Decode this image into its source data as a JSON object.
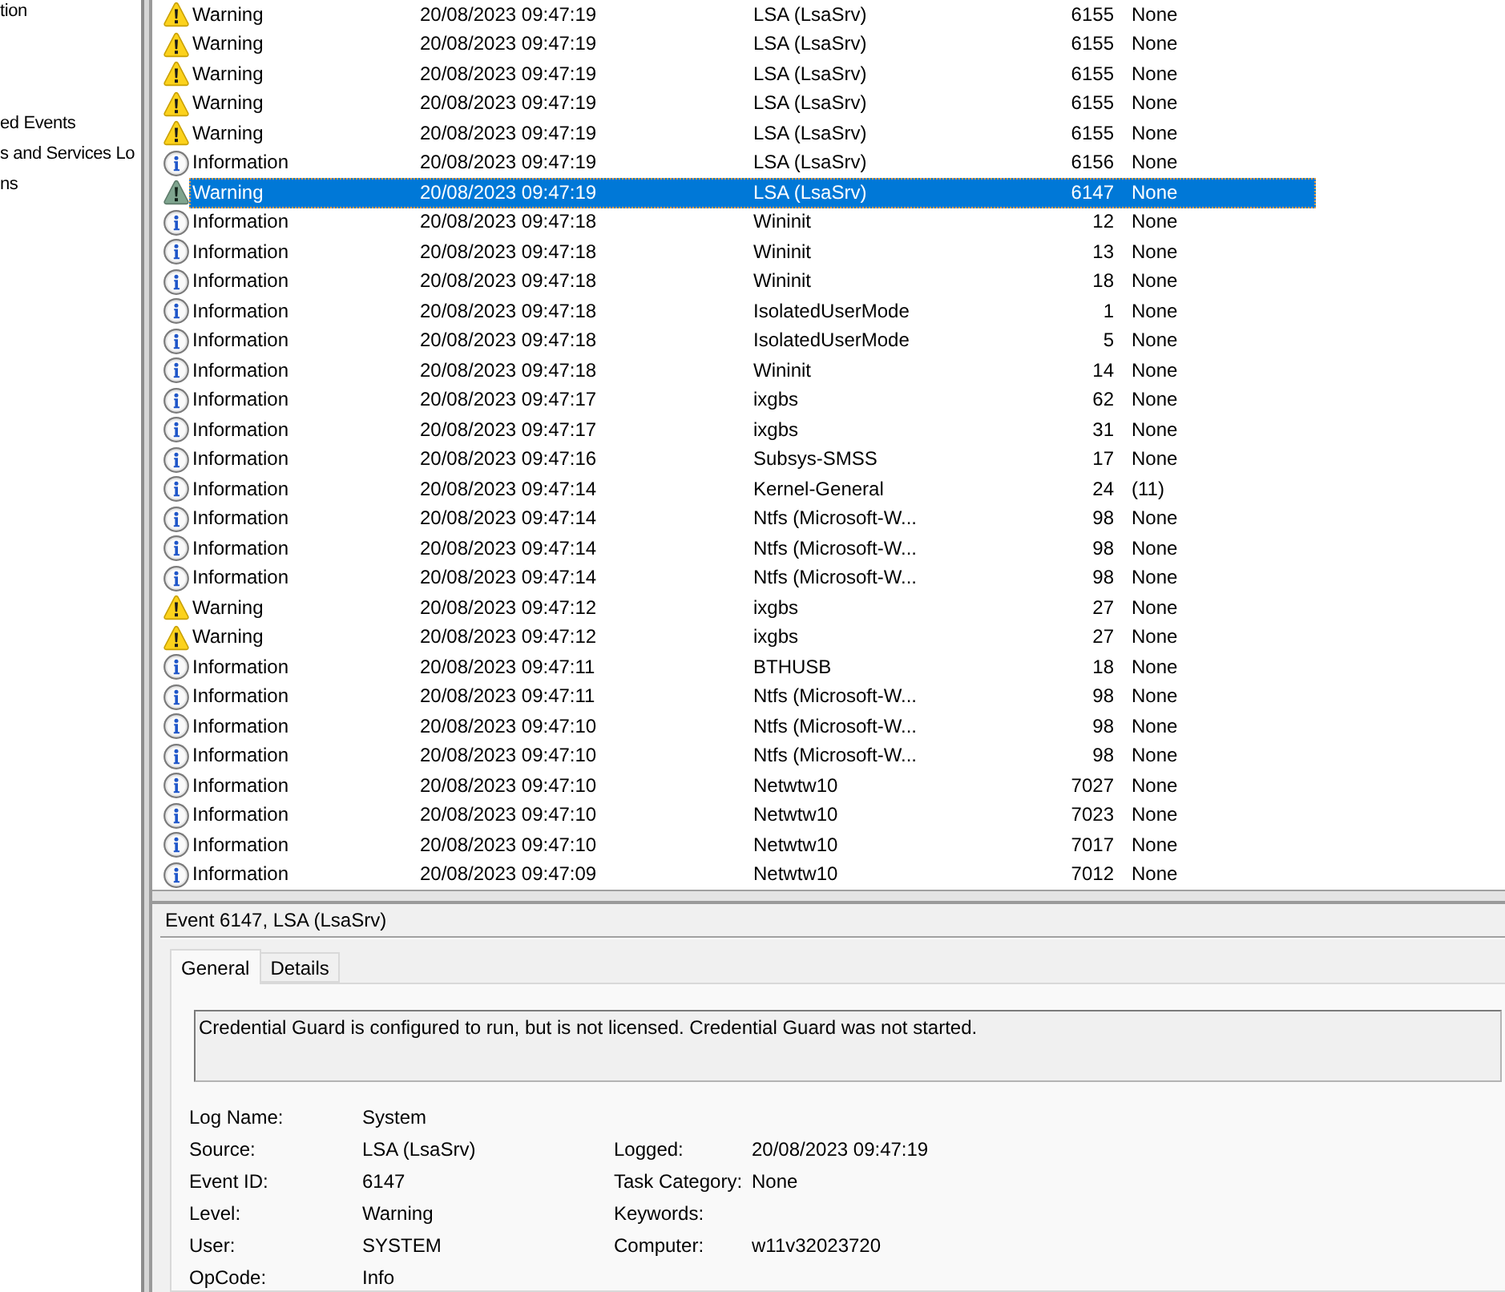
{
  "sidebar": {
    "items": [
      {
        "label": "tion"
      },
      {
        "label": "ed Events"
      },
      {
        "label": "s and Services Lo"
      },
      {
        "label": "ns"
      }
    ]
  },
  "events": {
    "rows": [
      {
        "kind": "warning",
        "level": "Warning",
        "date_time": "20/08/2023 09:47:19",
        "source": "LSA (LsaSrv)",
        "event_id": "6155",
        "task_category": "None",
        "selected": false
      },
      {
        "kind": "warning",
        "level": "Warning",
        "date_time": "20/08/2023 09:47:19",
        "source": "LSA (LsaSrv)",
        "event_id": "6155",
        "task_category": "None",
        "selected": false
      },
      {
        "kind": "warning",
        "level": "Warning",
        "date_time": "20/08/2023 09:47:19",
        "source": "LSA (LsaSrv)",
        "event_id": "6155",
        "task_category": "None",
        "selected": false
      },
      {
        "kind": "warning",
        "level": "Warning",
        "date_time": "20/08/2023 09:47:19",
        "source": "LSA (LsaSrv)",
        "event_id": "6155",
        "task_category": "None",
        "selected": false
      },
      {
        "kind": "warning",
        "level": "Warning",
        "date_time": "20/08/2023 09:47:19",
        "source": "LSA (LsaSrv)",
        "event_id": "6155",
        "task_category": "None",
        "selected": false
      },
      {
        "kind": "info",
        "level": "Information",
        "date_time": "20/08/2023 09:47:19",
        "source": "LSA (LsaSrv)",
        "event_id": "6156",
        "task_category": "None",
        "selected": false
      },
      {
        "kind": "warning",
        "level": "Warning",
        "date_time": "20/08/2023 09:47:19",
        "source": "LSA (LsaSrv)",
        "event_id": "6147",
        "task_category": "None",
        "selected": true
      },
      {
        "kind": "info",
        "level": "Information",
        "date_time": "20/08/2023 09:47:18",
        "source": "Wininit",
        "event_id": "12",
        "task_category": "None",
        "selected": false
      },
      {
        "kind": "info",
        "level": "Information",
        "date_time": "20/08/2023 09:47:18",
        "source": "Wininit",
        "event_id": "13",
        "task_category": "None",
        "selected": false
      },
      {
        "kind": "info",
        "level": "Information",
        "date_time": "20/08/2023 09:47:18",
        "source": "Wininit",
        "event_id": "18",
        "task_category": "None",
        "selected": false
      },
      {
        "kind": "info",
        "level": "Information",
        "date_time": "20/08/2023 09:47:18",
        "source": "IsolatedUserMode",
        "event_id": "1",
        "task_category": "None",
        "selected": false
      },
      {
        "kind": "info",
        "level": "Information",
        "date_time": "20/08/2023 09:47:18",
        "source": "IsolatedUserMode",
        "event_id": "5",
        "task_category": "None",
        "selected": false
      },
      {
        "kind": "info",
        "level": "Information",
        "date_time": "20/08/2023 09:47:18",
        "source": "Wininit",
        "event_id": "14",
        "task_category": "None",
        "selected": false
      },
      {
        "kind": "info",
        "level": "Information",
        "date_time": "20/08/2023 09:47:17",
        "source": "ixgbs",
        "event_id": "62",
        "task_category": "None",
        "selected": false
      },
      {
        "kind": "info",
        "level": "Information",
        "date_time": "20/08/2023 09:47:17",
        "source": "ixgbs",
        "event_id": "31",
        "task_category": "None",
        "selected": false
      },
      {
        "kind": "info",
        "level": "Information",
        "date_time": "20/08/2023 09:47:16",
        "source": "Subsys-SMSS",
        "event_id": "17",
        "task_category": "None",
        "selected": false
      },
      {
        "kind": "info",
        "level": "Information",
        "date_time": "20/08/2023 09:47:14",
        "source": "Kernel-General",
        "event_id": "24",
        "task_category": "(11)",
        "selected": false
      },
      {
        "kind": "info",
        "level": "Information",
        "date_time": "20/08/2023 09:47:14",
        "source": "Ntfs (Microsoft-W...",
        "event_id": "98",
        "task_category": "None",
        "selected": false
      },
      {
        "kind": "info",
        "level": "Information",
        "date_time": "20/08/2023 09:47:14",
        "source": "Ntfs (Microsoft-W...",
        "event_id": "98",
        "task_category": "None",
        "selected": false
      },
      {
        "kind": "info",
        "level": "Information",
        "date_time": "20/08/2023 09:47:14",
        "source": "Ntfs (Microsoft-W...",
        "event_id": "98",
        "task_category": "None",
        "selected": false
      },
      {
        "kind": "warning",
        "level": "Warning",
        "date_time": "20/08/2023 09:47:12",
        "source": "ixgbs",
        "event_id": "27",
        "task_category": "None",
        "selected": false
      },
      {
        "kind": "warning",
        "level": "Warning",
        "date_time": "20/08/2023 09:47:12",
        "source": "ixgbs",
        "event_id": "27",
        "task_category": "None",
        "selected": false
      },
      {
        "kind": "info",
        "level": "Information",
        "date_time": "20/08/2023 09:47:11",
        "source": "BTHUSB",
        "event_id": "18",
        "task_category": "None",
        "selected": false
      },
      {
        "kind": "info",
        "level": "Information",
        "date_time": "20/08/2023 09:47:11",
        "source": "Ntfs (Microsoft-W...",
        "event_id": "98",
        "task_category": "None",
        "selected": false
      },
      {
        "kind": "info",
        "level": "Information",
        "date_time": "20/08/2023 09:47:10",
        "source": "Ntfs (Microsoft-W...",
        "event_id": "98",
        "task_category": "None",
        "selected": false
      },
      {
        "kind": "info",
        "level": "Information",
        "date_time": "20/08/2023 09:47:10",
        "source": "Ntfs (Microsoft-W...",
        "event_id": "98",
        "task_category": "None",
        "selected": false
      },
      {
        "kind": "info",
        "level": "Information",
        "date_time": "20/08/2023 09:47:10",
        "source": "Netwtw10",
        "event_id": "7027",
        "task_category": "None",
        "selected": false
      },
      {
        "kind": "info",
        "level": "Information",
        "date_time": "20/08/2023 09:47:10",
        "source": "Netwtw10",
        "event_id": "7023",
        "task_category": "None",
        "selected": false
      },
      {
        "kind": "info",
        "level": "Information",
        "date_time": "20/08/2023 09:47:10",
        "source": "Netwtw10",
        "event_id": "7017",
        "task_category": "None",
        "selected": false
      },
      {
        "kind": "info",
        "level": "Information",
        "date_time": "20/08/2023 09:47:09",
        "source": "Netwtw10",
        "event_id": "7012",
        "task_category": "None",
        "selected": false
      }
    ]
  },
  "detail": {
    "title": "Event 6147, LSA (LsaSrv)",
    "tabs": [
      {
        "label": "General",
        "selected": true
      },
      {
        "label": "Details",
        "selected": false
      }
    ],
    "message": "Credential Guard is configured to run, but is not licensed. Credential Guard was not started.",
    "fields": [
      {
        "left": {
          "label": "Log Name:",
          "value": "System"
        }
      },
      {
        "left": {
          "label": "Source:",
          "value": "LSA (LsaSrv)"
        },
        "right": {
          "label": "Logged:",
          "value": "20/08/2023 09:47:19"
        }
      },
      {
        "left": {
          "label": "Event ID:",
          "value": "6147"
        },
        "right": {
          "label": "Task Category:",
          "value": "None"
        }
      },
      {
        "left": {
          "label": "Level:",
          "value": "Warning"
        },
        "right": {
          "label": "Keywords:"
        }
      },
      {
        "left": {
          "label": "User:",
          "value": "SYSTEM"
        },
        "right": {
          "label": "Computer:",
          "value": "w11v32023720"
        }
      },
      {
        "left": {
          "label": "OpCode:",
          "value": "Info"
        }
      }
    ]
  }
}
